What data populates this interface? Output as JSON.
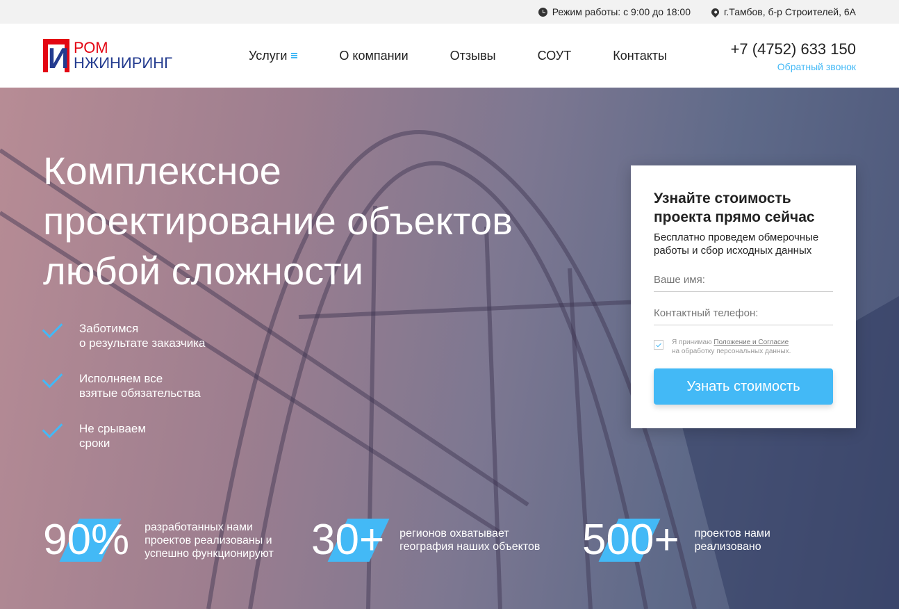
{
  "topbar": {
    "hours": "Режим работы: с 9:00 до 18:00",
    "address": "г.Тамбов, б-р Строителей, 6А"
  },
  "logo": {
    "mark": "И",
    "line1": "РОМ",
    "line2": "НЖИНИРИНГ"
  },
  "nav": [
    {
      "label": "Услуги"
    },
    {
      "label": "О компании"
    },
    {
      "label": "Отзывы"
    },
    {
      "label": "СОУТ"
    },
    {
      "label": "Контакты"
    }
  ],
  "contact": {
    "phone": "+7 (4752) 633 150",
    "callback": "Обратный звонок"
  },
  "hero": {
    "title": "Комплексное проектирование объектов любой сложности",
    "features": [
      {
        "l1": "Заботимся",
        "l2": "о результате заказчика"
      },
      {
        "l1": "Исполняем все",
        "l2": "взятые обязательства"
      },
      {
        "l1": "Не срываем",
        "l2": "сроки"
      }
    ],
    "stats": [
      {
        "value": "90%",
        "desc": "разработанных нами проектов реализованы и успешно функционируют"
      },
      {
        "value": "30+",
        "desc": "регионов охватывает география наших объектов"
      },
      {
        "value": "500+",
        "desc": "проектов нами реализовано"
      }
    ]
  },
  "form": {
    "title": "Узнайте стоимость проекта прямо сейчас",
    "subtitle": "Бесплатно проведем обмерочные работы и сбор исходных данных",
    "name_placeholder": "Ваше имя:",
    "phone_placeholder": "Контактный телефон:",
    "agree_prefix": "Я принимаю ",
    "agree_link": "Положение и Согласие",
    "agree_suffix": "на обработку персональных данных.",
    "submit": "Узнать стоимость",
    "agree_checked": true
  },
  "colors": {
    "accent": "#43b9f6",
    "brand_red": "#e30613",
    "brand_blue": "#233b8f"
  }
}
